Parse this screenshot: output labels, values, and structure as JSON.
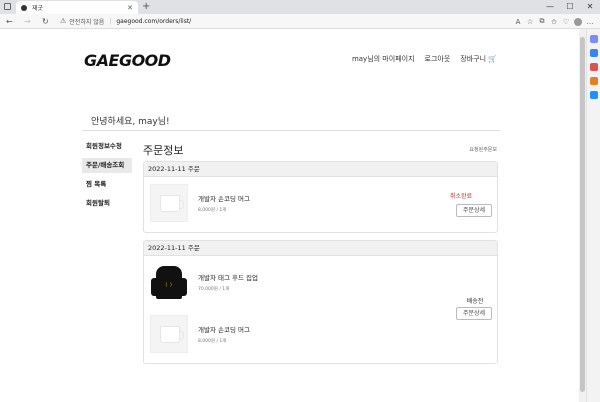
{
  "browser": {
    "tab_title": "재굿",
    "address_warning": "안전하지 않음",
    "url": "gaegood.com/orders/list/"
  },
  "site": {
    "logo": "GAEGOOD",
    "nav": [
      "may님의 마이페이지",
      "로그아웃",
      "장바구니"
    ],
    "greeting": "안녕하세요, may님!"
  },
  "sidebar": {
    "items": [
      "회원정보수정",
      "주문/배송조회",
      "찜 목록",
      "회원탈퇴"
    ]
  },
  "main": {
    "title": "주문정보",
    "cancelled_link": "요청된주문보",
    "orders": [
      {
        "date": "2022-11-11 주문",
        "status": "취소완료",
        "button": "주문상세",
        "items": [
          {
            "name": "개발자 손코딩 머그",
            "meta": "8,000원 / 1개"
          }
        ]
      },
      {
        "date": "2022-11-11 주문",
        "status": "배송전",
        "button": "주문상세",
        "items": [
          {
            "name": "개발자 태그 후드 집업",
            "meta": "70,000원 / 1개"
          },
          {
            "name": "개발자 손코딩 머그",
            "meta": "8,000원 / 1개"
          }
        ]
      }
    ]
  },
  "colors": {
    "cancel_status": "#c0392b",
    "accent": "#111111"
  }
}
